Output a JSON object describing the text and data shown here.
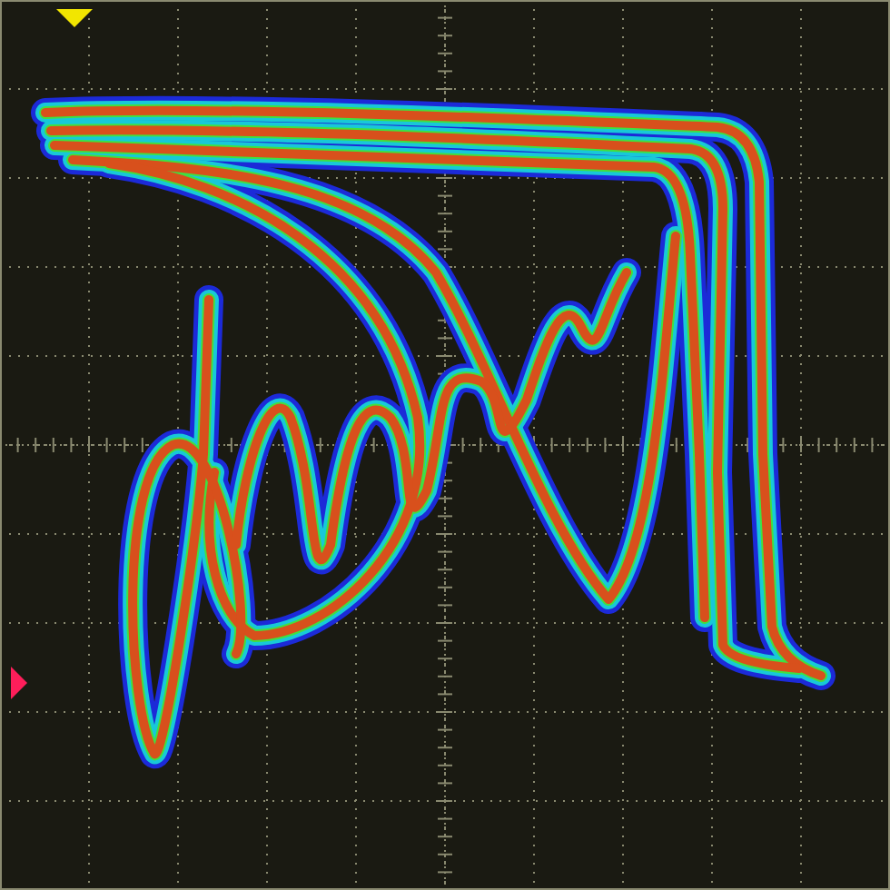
{
  "display": {
    "graticule": true
  },
  "markers": [
    {
      "kind": "trigger",
      "color": "#f2e600"
    },
    {
      "kind": "level",
      "color": "#ff1e5a"
    }
  ]
}
